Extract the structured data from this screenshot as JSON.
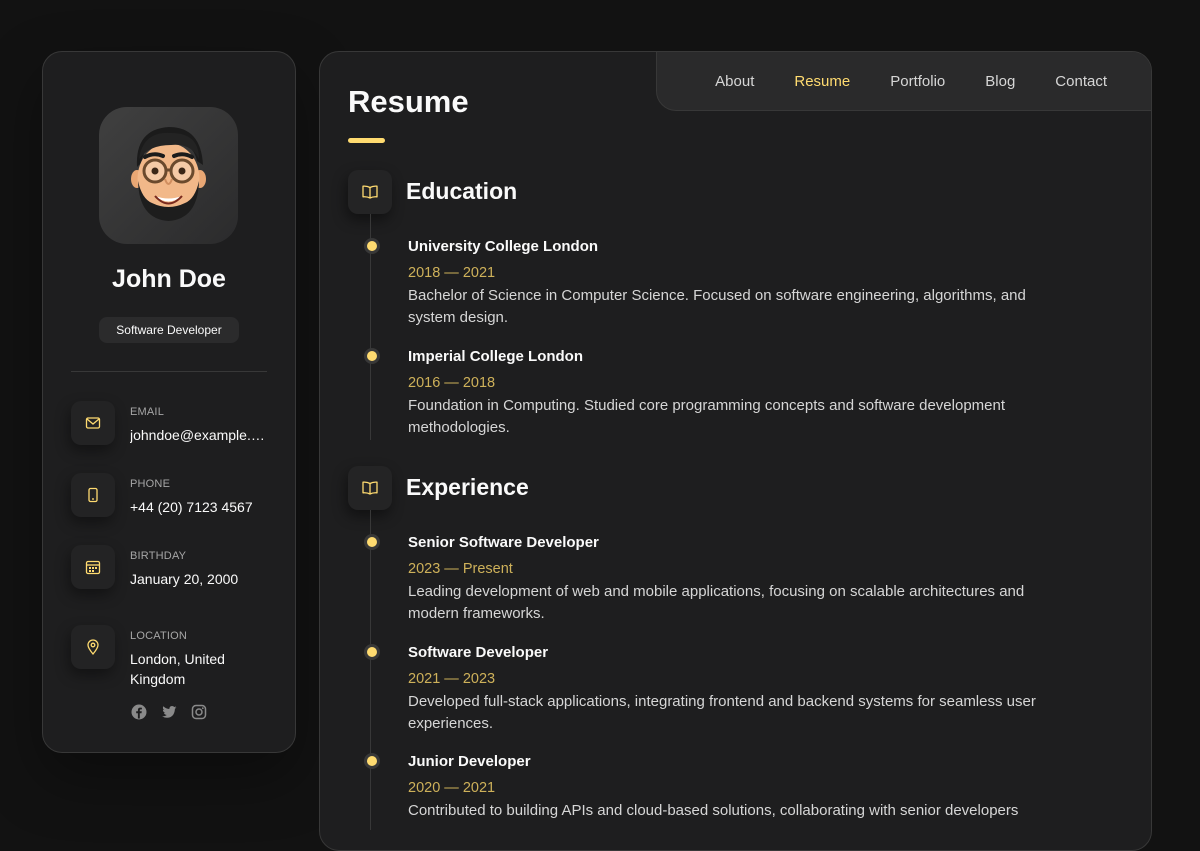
{
  "profile": {
    "name": "John Doe",
    "title": "Software Developer"
  },
  "contacts": [
    {
      "label": "Email",
      "value": "johndoe@example.com",
      "icon": "mail-icon"
    },
    {
      "label": "Phone",
      "value": "+44 (20) 7123 4567",
      "icon": "phone-icon"
    },
    {
      "label": "Birthday",
      "value": "January 20, 2000",
      "icon": "calendar-icon"
    },
    {
      "label": "Location",
      "value": "London, United Kingdom",
      "icon": "location-pin-icon"
    }
  ],
  "socials": [
    "facebook-icon",
    "twitter-icon",
    "instagram-icon"
  ],
  "nav": {
    "items": [
      "About",
      "Resume",
      "Portfolio",
      "Blog",
      "Contact"
    ],
    "active": "Resume"
  },
  "page": {
    "title": "Resume"
  },
  "education": {
    "heading": "Education",
    "items": [
      {
        "org": "University College London",
        "years": "2018 — 2021",
        "desc": "Bachelor of Science in Computer Science. Focused on software engineering, algorithms, and system design."
      },
      {
        "org": "Imperial College London",
        "years": "2016 — 2018",
        "desc": "Foundation in Computing. Studied core programming concepts and software development methodologies."
      }
    ]
  },
  "experience": {
    "heading": "Experience",
    "items": [
      {
        "org": "Senior Software Developer",
        "years": "2023 — Present",
        "desc": "Leading development of web and mobile applications, focusing on scalable architectures and modern frameworks."
      },
      {
        "org": "Software Developer",
        "years": "2021 — 2023",
        "desc": "Developed full-stack applications, integrating frontend and backend systems for seamless user experiences."
      },
      {
        "org": "Junior Developer",
        "years": "2020 — 2021",
        "desc": "Contributed to building APIs and cloud-based solutions, collaborating with senior developers"
      }
    ]
  },
  "colors": {
    "accent": "#ffdb70",
    "background": "#121212",
    "card": "#1e1e1f"
  }
}
